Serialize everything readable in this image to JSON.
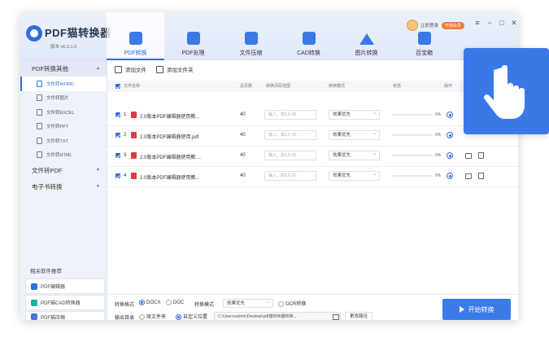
{
  "app": {
    "title": "PDF猫转换器",
    "version": "版本 v6.0.1.0"
  },
  "header": {
    "tabs": [
      {
        "label": "PDF转换",
        "icon": "pdf-convert-icon",
        "active": true
      },
      {
        "label": "PDF处理",
        "icon": "pdf-process-icon"
      },
      {
        "label": "文件压缩",
        "icon": "file-compress-icon"
      },
      {
        "label": "CAD转换",
        "icon": "cad-convert-icon"
      },
      {
        "label": "图片转换",
        "icon": "image-convert-icon"
      },
      {
        "label": "百宝箱",
        "icon": "toolbox-icon"
      }
    ],
    "login": "立即登录",
    "vip": "开通会员",
    "window_controls": [
      "≡",
      "−",
      "□",
      "✕"
    ]
  },
  "sidebar": {
    "sections": [
      {
        "label": "PDF转换其他",
        "open": true,
        "items": [
          "文件转WORD",
          "文件转图片",
          "文件转EXCEL",
          "文件转PPT",
          "文件转TXT",
          "文件转HTML"
        ]
      },
      {
        "label": "文件转PDF",
        "open": false
      },
      {
        "label": "电子书转换",
        "open": false
      }
    ],
    "recommend_title": "相关软件推荐",
    "recommend": [
      {
        "label": "PDF编辑器",
        "color": "#2f6de0"
      },
      {
        "label": "PDF猫CAD转换器",
        "color": "#18b4a0"
      },
      {
        "label": "PDF猫压缩",
        "color": "#4a72d8"
      }
    ]
  },
  "toolbar": {
    "add_file": "添加文件",
    "add_folder": "添加文件夹"
  },
  "table": {
    "columns": {
      "name": "文件名称",
      "pages": "总页数",
      "range": "转换页码范围",
      "mode": "转换模式",
      "status": "状态",
      "action": "操作"
    },
    "rows": [
      {
        "num": "1",
        "name": "2.0版本PDF编辑器使用教...",
        "pages": "40",
        "range_placeholder": "输入，如1,5-10",
        "mode": "效果优先",
        "pct": "0%"
      },
      {
        "num": "2",
        "name": "2.0版本PDF编辑器使用.pdf",
        "pages": "40",
        "range_placeholder": "输入，如1,5-10",
        "mode": "效果优先",
        "pct": "0%"
      },
      {
        "num": "3",
        "name": "2.0版本PDF编辑器使用教.p...",
        "pages": "40",
        "range_placeholder": "输入，如1,5-10",
        "mode": "效果优先",
        "pct": "0%"
      },
      {
        "num": "4",
        "name": "2.0版本PDF编辑器使用教...",
        "pages": "40",
        "range_placeholder": "输入，如1,5-10",
        "mode": "效果优先",
        "pct": "0%"
      }
    ]
  },
  "footer": {
    "format_label": "转换格式",
    "docx": "DOCX",
    "doc": "DOC",
    "mode_label": "转换模式",
    "mode_value": "效果优先",
    "ocr": "OCR转换",
    "output_label": "输出目录",
    "orig_folder": "原文件夹",
    "custom": "自定义位置",
    "path": "C:\\Users\\admin\\Desktop\\pdf猫转换器转换...",
    "change_btn": "更改路径",
    "start_btn": "开始转换"
  },
  "accent": "#2f6de0"
}
